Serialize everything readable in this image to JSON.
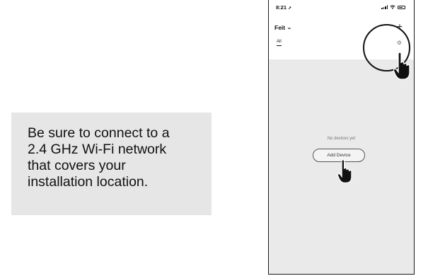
{
  "instruction": {
    "lines": [
      "Be sure to connect to a",
      "2.4 GHz Wi-Fi network",
      "that covers your",
      "installation location."
    ]
  },
  "phone": {
    "status_bar": {
      "time": "8:21"
    },
    "header": {
      "home_name": "Feit",
      "add_symbol": "+"
    },
    "tabs": [
      {
        "label": "All",
        "selected": true
      }
    ],
    "empty_state": {
      "message": "No devices yet",
      "add_button_label": "Add Device"
    }
  },
  "icons": {
    "location-arrow": "location-arrow-icon",
    "signal": "signal-icon",
    "wifi": "wifi-icon",
    "battery": "battery-icon",
    "chevron": "chevron-down-icon",
    "plus": "plus-icon",
    "gear": "gear-icon",
    "pointer": "pointing-hand-icon"
  },
  "colors": {
    "callout_background": "#e6e6e6",
    "content_background": "#eaeaea",
    "text_primary": "#111111",
    "text_secondary": "#777777"
  }
}
